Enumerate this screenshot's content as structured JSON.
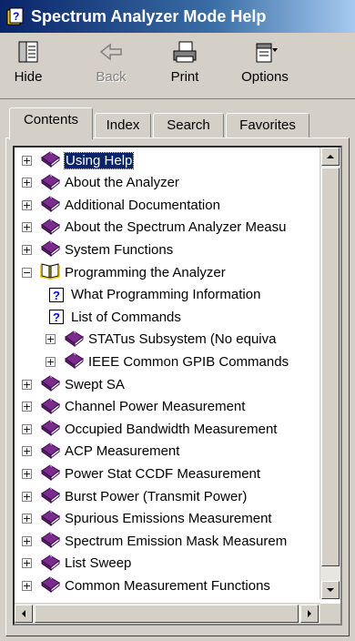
{
  "window": {
    "title": "Spectrum Analyzer Mode Help"
  },
  "toolbar": {
    "hide_label": "Hide",
    "back_label": "Back",
    "print_label": "Print",
    "options_label": "Options"
  },
  "tabs": {
    "contents": "Contents",
    "index": "Index",
    "search": "Search",
    "favorites": "Favorites"
  },
  "tree": {
    "items": [
      {
        "label": "Using Help",
        "type": "book",
        "expander": "+",
        "selected": true
      },
      {
        "label": "About the Analyzer",
        "type": "book",
        "expander": "+"
      },
      {
        "label": "Additional Documentation",
        "type": "book",
        "expander": "+"
      },
      {
        "label": "About the Spectrum Analyzer Measu",
        "type": "book",
        "expander": "+"
      },
      {
        "label": "System Functions",
        "type": "book",
        "expander": "+"
      },
      {
        "label": "Programming the Analyzer",
        "type": "open-book",
        "expander": "−"
      },
      {
        "label": "What Programming Information",
        "type": "page"
      },
      {
        "label": "List of Commands",
        "type": "page"
      },
      {
        "label": "STATus Subsystem (No equiva",
        "type": "book",
        "expander": "+"
      },
      {
        "label": "IEEE Common GPIB Commands",
        "type": "book",
        "expander": "+"
      },
      {
        "label": "Swept SA",
        "type": "book",
        "expander": "+"
      },
      {
        "label": "Channel Power Measurement",
        "type": "book",
        "expander": "+"
      },
      {
        "label": "Occupied Bandwidth Measurement",
        "type": "book",
        "expander": "+"
      },
      {
        "label": "ACP Measurement",
        "type": "book",
        "expander": "+"
      },
      {
        "label": "Power Stat CCDF Measurement",
        "type": "book",
        "expander": "+"
      },
      {
        "label": "Burst Power (Transmit Power)",
        "type": "book",
        "expander": "+"
      },
      {
        "label": "Spurious Emissions Measurement",
        "type": "book",
        "expander": "+"
      },
      {
        "label": "Spectrum Emission Mask Measurem",
        "type": "book",
        "expander": "+"
      },
      {
        "label": "List Sweep",
        "type": "book",
        "expander": "+"
      },
      {
        "label": "Common Measurement Functions",
        "type": "book",
        "expander": "+"
      }
    ]
  },
  "icons": {
    "title": "help-book-icon",
    "hide": "hide-pane-icon",
    "back": "back-arrow-icon",
    "print": "printer-icon",
    "options": "options-icon",
    "page": "help-page-icon"
  },
  "colors": {
    "selection": "#0a246a",
    "book_purple": "#7a2b8c",
    "title_bar": "#0a246a"
  }
}
